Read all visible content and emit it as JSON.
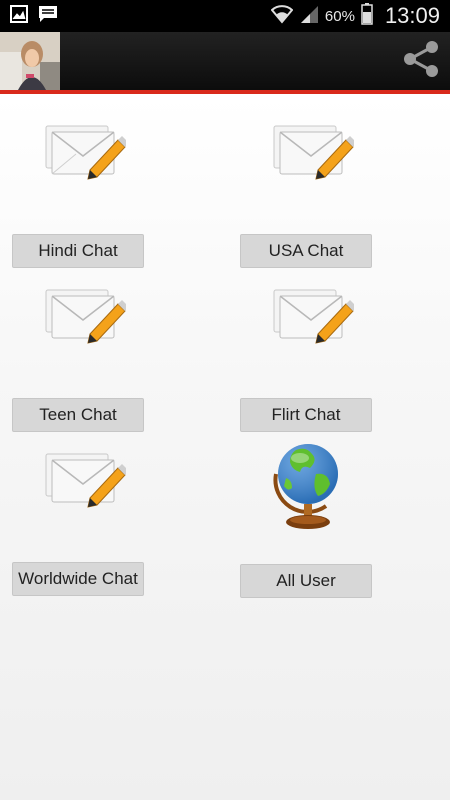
{
  "status_bar": {
    "battery_percent": "60%",
    "time": "13:09"
  },
  "tiles": [
    {
      "label": "Hindi Chat",
      "icon": "envelope-pencil-icon"
    },
    {
      "label": "USA Chat",
      "icon": "envelope-pencil-icon"
    },
    {
      "label": "Teen Chat",
      "icon": "envelope-pencil-icon"
    },
    {
      "label": "Flirt Chat",
      "icon": "envelope-pencil-icon"
    },
    {
      "label": "Worldwide Chat",
      "icon": "envelope-pencil-icon"
    },
    {
      "label": "All User",
      "icon": "globe-icon"
    }
  ],
  "colors": {
    "accent_line": "#d92a1c",
    "action_bar": "#111111",
    "button_bg": "#d7d7d7"
  }
}
